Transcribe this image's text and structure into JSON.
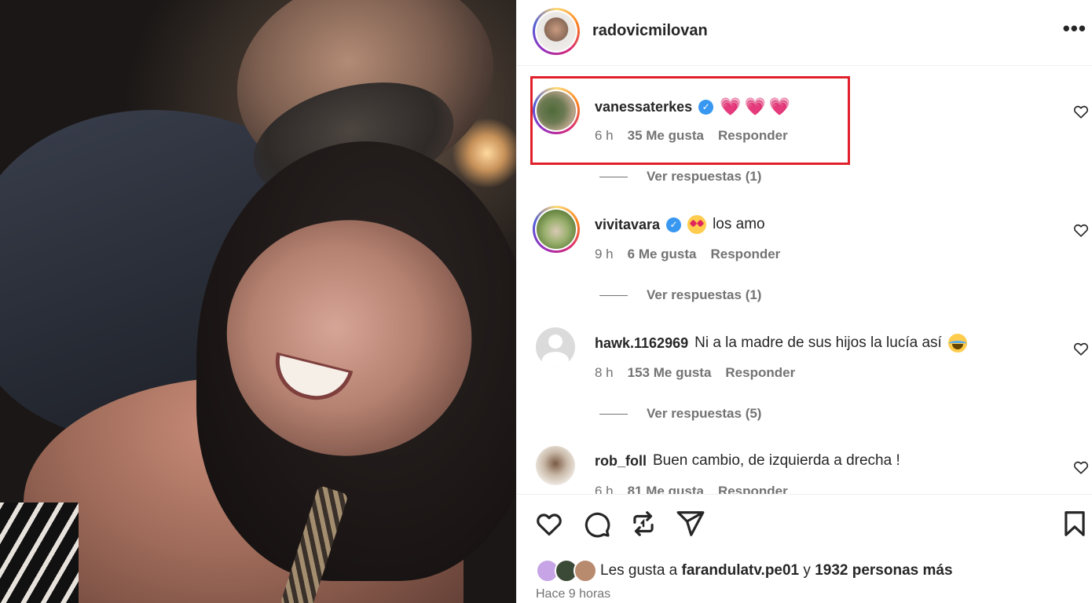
{
  "post": {
    "owner": "radovicmilovan",
    "more_icon": "more-horizontal-icon"
  },
  "comments": [
    {
      "user": "vanessaterkes",
      "verified": true,
      "text": "💗💗💗",
      "time": "6 h",
      "likes": "35 Me gusta",
      "reply": "Responder",
      "view_replies": "Ver respuestas (1)",
      "highlighted": true
    },
    {
      "user": "vivitavara",
      "verified": true,
      "text": "los amo",
      "time": "9 h",
      "likes": "6 Me gusta",
      "reply": "Responder",
      "view_replies": "Ver respuestas (1)"
    },
    {
      "user": "hawk.1162969",
      "verified": false,
      "text": "Ni a la madre de sus hijos la lucía así",
      "time": "8 h",
      "likes": "153 Me gusta",
      "reply": "Responder",
      "view_replies": "Ver respuestas (5)"
    },
    {
      "user": "rob_foll",
      "verified": false,
      "text": "Buen cambio, de izquierda a drecha !",
      "time": "6 h",
      "likes": "81 Me gusta",
      "reply": "Responder"
    }
  ],
  "likes": {
    "prefix": "Les gusta a",
    "user": "farandulatv.pe01",
    "conjunction": "y",
    "others": "1932 personas más"
  },
  "time_ago": "Hace 9 horas",
  "colors": {
    "highlight_box": "#e0212b",
    "verified": "#3897f0",
    "secondary_text": "#737373"
  }
}
